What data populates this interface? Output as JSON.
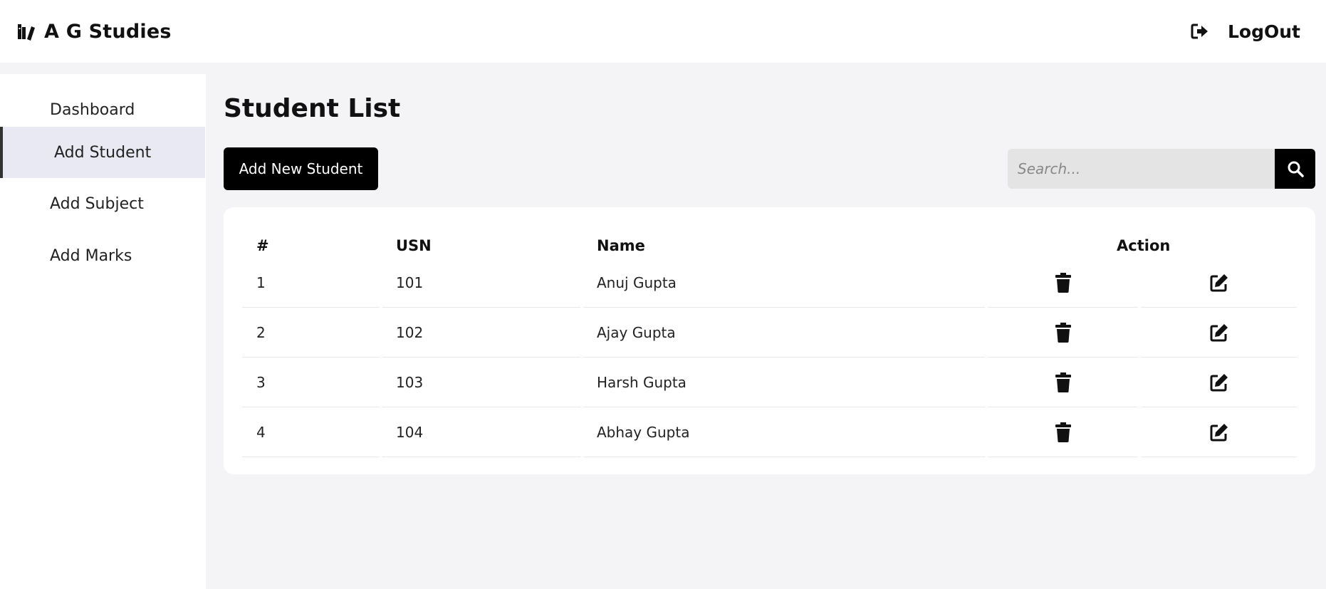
{
  "header": {
    "brand": "A G Studies",
    "brand_icon": "books-icon",
    "logout_label": "LogOut",
    "logout_icon": "sign-out-icon"
  },
  "sidebar": {
    "items": [
      {
        "label": "Dashboard",
        "active": false
      },
      {
        "label": "Add Student",
        "active": true
      },
      {
        "label": "Add Subject",
        "active": false
      },
      {
        "label": "Add Marks",
        "active": false
      }
    ]
  },
  "main": {
    "title": "Student List",
    "add_button": "Add New Student",
    "search_placeholder": "Search...",
    "search_icon": "search-icon"
  },
  "table": {
    "headers": {
      "index": "#",
      "usn": "USN",
      "name": "Name",
      "action": "Action"
    },
    "rows": [
      {
        "index": "1",
        "usn": "101",
        "name": "Anuj Gupta"
      },
      {
        "index": "2",
        "usn": "102",
        "name": "Ajay Gupta"
      },
      {
        "index": "3",
        "usn": "103",
        "name": "Harsh Gupta"
      },
      {
        "index": "4",
        "usn": "104",
        "name": "Abhay Gupta"
      }
    ],
    "row_icons": {
      "delete": "trash-icon",
      "edit": "edit-icon"
    }
  },
  "colors": {
    "background": "#f4f4f7",
    "surface": "#ffffff",
    "accent": "#000000",
    "active_item": "#e9e9f3"
  }
}
